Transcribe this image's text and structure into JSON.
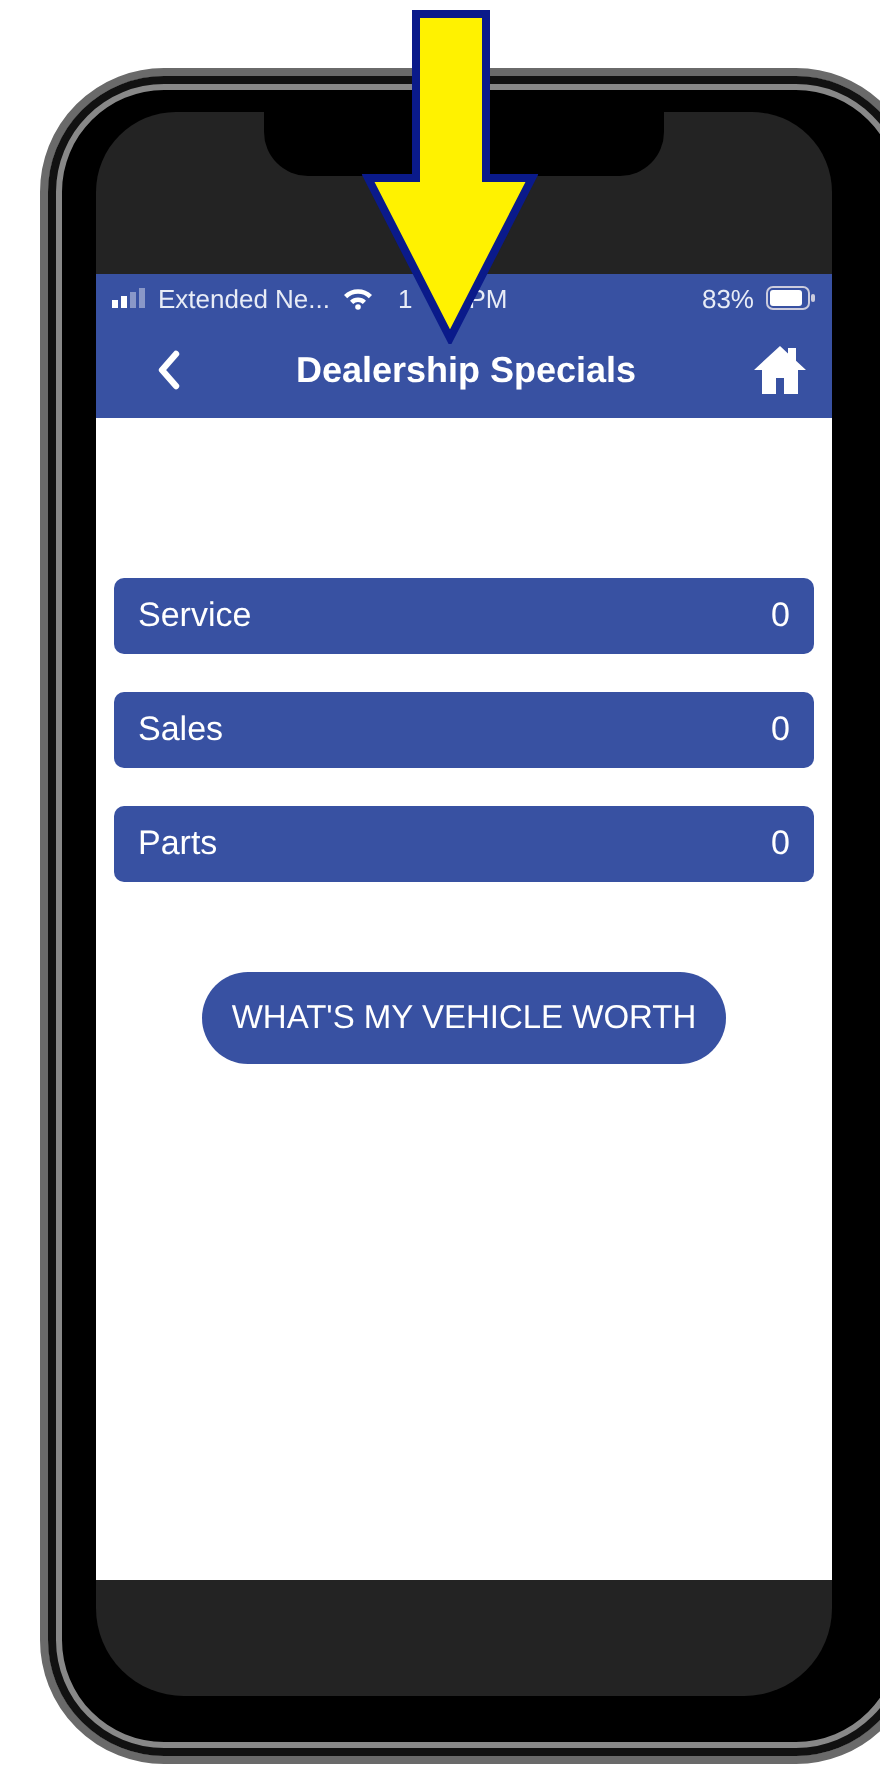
{
  "status_bar": {
    "carrier": "Extended Ne...",
    "time_parts": [
      "1",
      "PM"
    ],
    "battery": "83%"
  },
  "nav_bar": {
    "title": "Dealership Specials"
  },
  "categories": [
    {
      "label": "Service",
      "count": "0"
    },
    {
      "label": "Sales",
      "count": "0"
    },
    {
      "label": "Parts",
      "count": "0"
    }
  ],
  "action_button": "WHAT'S MY VEHICLE WORTH"
}
